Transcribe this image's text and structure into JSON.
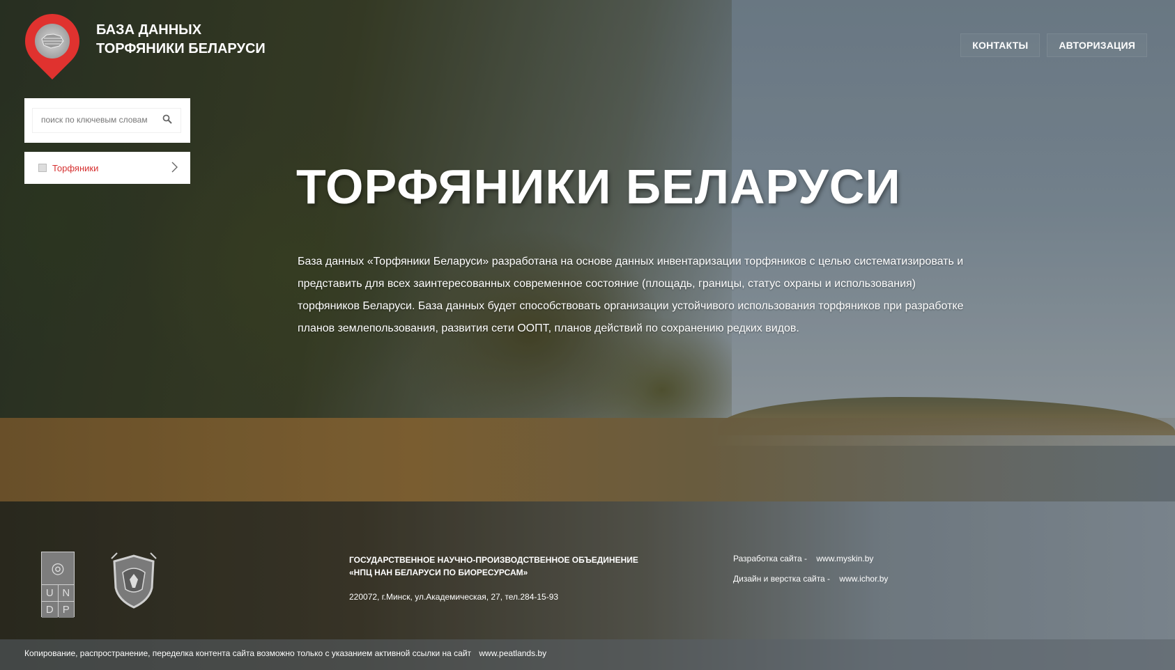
{
  "brand": {
    "line1": "БАЗА ДАННЫХ",
    "line2": "ТОРФЯНИКИ БЕЛАРУСИ",
    "logo_icon": "map-pin-logo-icon"
  },
  "nav": {
    "contacts": "КОНТАКТЫ",
    "login": "АВТОРИЗАЦИЯ"
  },
  "search": {
    "placeholder": "поиск по ключевым словам",
    "icon": "search-icon"
  },
  "sidebar": {
    "items": [
      {
        "label": "Торфяники",
        "icon": "grid-icon",
        "chevron": "chevron-right-icon"
      }
    ]
  },
  "hero": {
    "title": "ТОРФЯНИКИ БЕЛАРУСИ",
    "description": "База данных «Торфяники Беларуси» разработана на основе данных инвентаризации торфяников с целью систематизировать и представить для всех заинтересованных современное состояние (площадь, границы, статус охраны и использования) торфяников Беларуси. База данных будет способствовать организации устойчивого использования торфяников при разработке планов землепользования, развития сети ООПТ, планов действий по сохранению редких видов."
  },
  "footer": {
    "undp_letters": [
      "U",
      "N",
      "D",
      "P"
    ],
    "org_line1": "ГОСУДАРСТВЕННОЕ НАУЧНО-ПРОИЗВОДСТВЕННОЕ ОБЪЕДИНЕНИЕ",
    "org_line2": "«НПЦ НАН БЕЛАРУСИ ПО БИОРЕСУРСАМ»",
    "address": "220072, г.Минск, ул.Академическая, 27, тел.284-15-93",
    "dev_label": "Разработка сайта -",
    "dev_link": "www.myskin.by",
    "design_label": "Дизайн и верстка сайта -",
    "design_link": "www.ichor.by",
    "copyright": "Копирование, распространение, переделка контента сайта возможно только с указанием активной ссылки на сайт",
    "copyright_link": "www.peatlands.by"
  },
  "colors": {
    "accent_red": "#e0322f",
    "menu_text_red": "#d63030"
  }
}
